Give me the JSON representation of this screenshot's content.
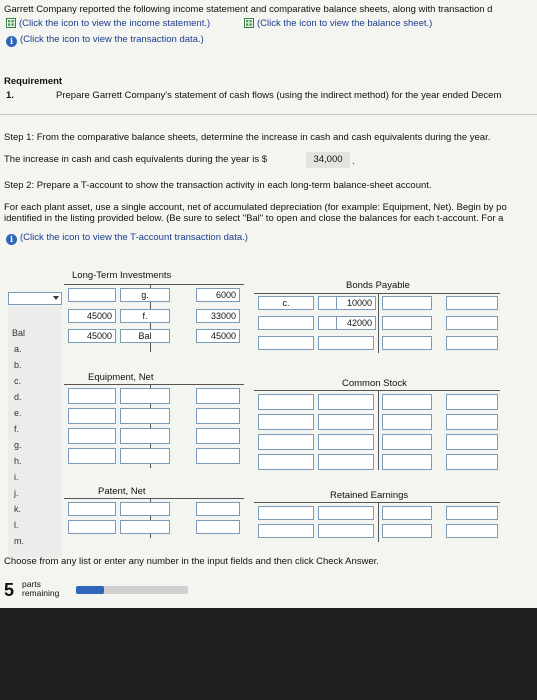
{
  "header": {
    "line1": "Garrett Company reported the following income statement and comparative balance sheets, along with transaction d",
    "income_link": "(Click the icon to view the income statement.)",
    "balance_link": "(Click the icon to view the balance sheet.)",
    "transaction_link": "(Click the icon to view the transaction data.)"
  },
  "requirement": {
    "title": "Requirement",
    "number": "1.",
    "text": "Prepare Garrett Company's statement of cash flows (using the indirect method) for the year ended Decem"
  },
  "step1": {
    "text": "Step 1: From the comparative balance sheets, determine the increase in cash and cash equivalents during the year.",
    "answer_prefix": "The increase in cash and cash equivalents during the year is $",
    "answer_value": "34,000",
    "answer_suffix": "."
  },
  "step2": {
    "title": "Step 2: Prepare a T-account to show the transaction activity in each long-term balance-sheet account.",
    "instr1": "For each plant asset, use a single account, net of accumulated depreciation (for example: Equipment, Net). Begin by po",
    "instr2": "identified in the listing provided below. (Be sure to select \"Bal\" to open and close the balances for each t-account. For a",
    "tdata_link": "(Click the icon to view the T-account transaction data.)"
  },
  "taccounts": {
    "long_term_investments": {
      "title": "Long-Term Investments",
      "debits": [
        "",
        "45000",
        "45000"
      ],
      "credit_labels": [
        "g.",
        "f.",
        "Bal"
      ],
      "credits": [
        "6000",
        "33000",
        "45000"
      ]
    },
    "bonds_payable": {
      "title": "Bonds Payable",
      "debit_label": "c.",
      "credits": [
        "10000",
        "42000",
        ""
      ]
    },
    "equipment_net": {
      "title": "Equipment, Net"
    },
    "common_stock": {
      "title": "Common Stock"
    },
    "patent_net": {
      "title": "Patent, Net"
    },
    "retained_earnings": {
      "title": "Retained Earnings"
    }
  },
  "dropdown_list": [
    "Bal",
    "a.",
    "b.",
    "c.",
    "d.",
    "e.",
    "f.",
    "g.",
    "h.",
    "i.",
    "j.",
    "k.",
    "l.",
    "m."
  ],
  "footer": {
    "instruction": "Choose from any list or enter any number in the input fields and then click Check Answer.",
    "parts_count": "5",
    "parts_label1": "parts",
    "parts_label2": "remaining",
    "progress": 0.25
  },
  "colors": {
    "icon_green": "#4a9a58",
    "info_blue": "#2f66b8",
    "progress": "#2f66b8",
    "box_border": "#7a9bb8"
  }
}
